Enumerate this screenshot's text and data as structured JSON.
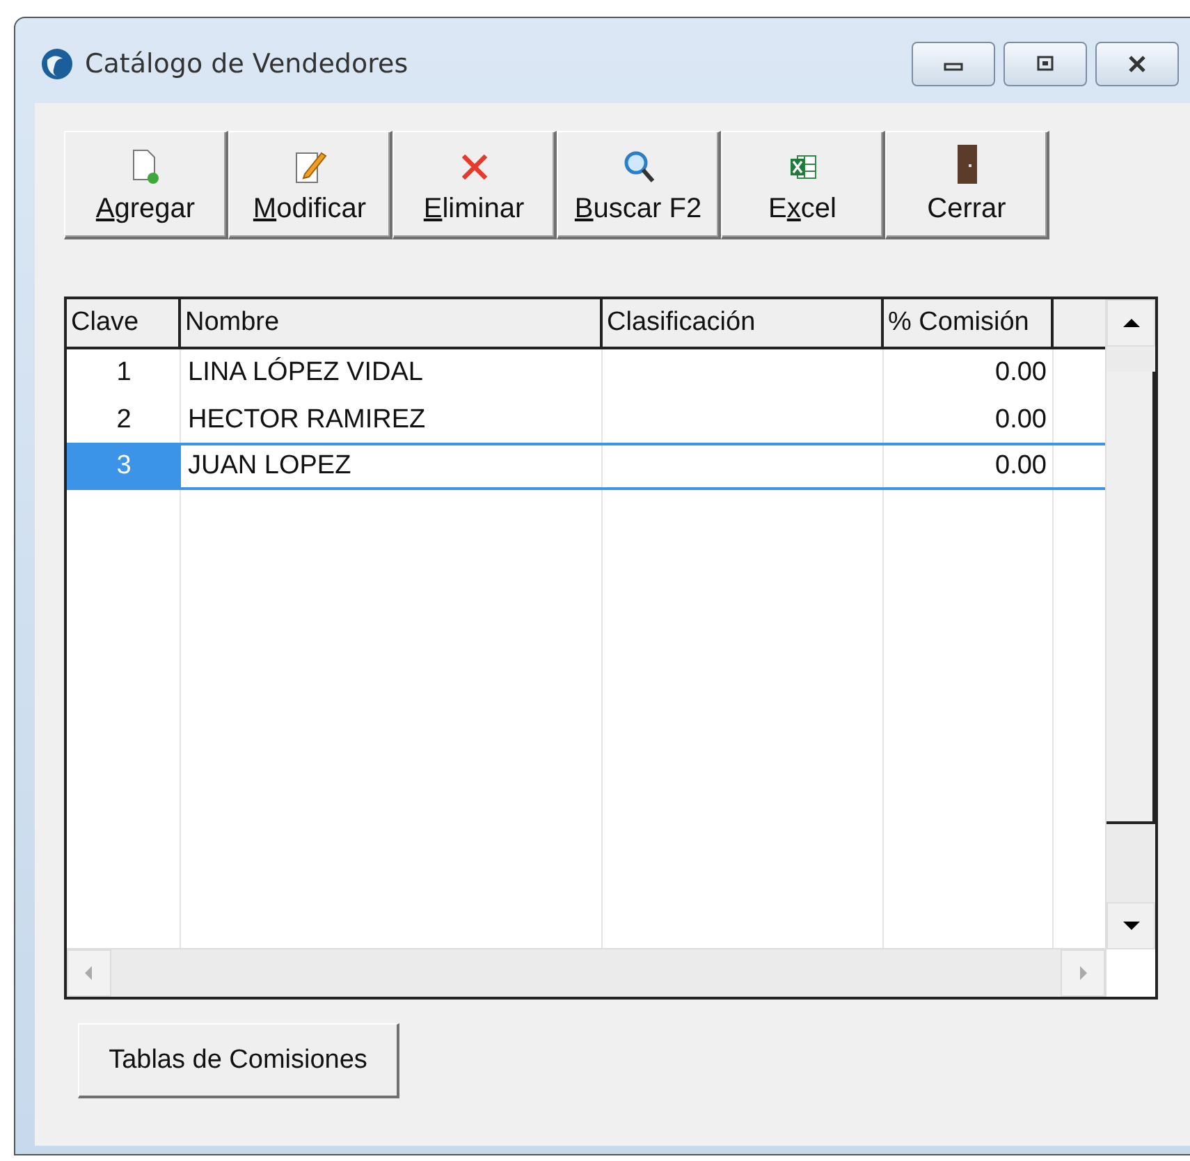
{
  "window": {
    "title": "Catálogo de Vendedores"
  },
  "toolbar": [
    {
      "kind": "add",
      "key": "A",
      "post": "gregar"
    },
    {
      "kind": "edit",
      "key": "M",
      "post": "odificar"
    },
    {
      "kind": "delete",
      "key": "E",
      "post": "liminar"
    },
    {
      "kind": "search",
      "key": "B",
      "post": "uscar F2"
    },
    {
      "kind": "excel",
      "pre": "E",
      "key": "x",
      "post": "cel"
    },
    {
      "kind": "exit",
      "pre": "Cerrar"
    }
  ],
  "table": {
    "columns": [
      "Clave",
      "Nombre",
      "Clasificación",
      "% Comisión"
    ],
    "rows": [
      {
        "clave": "1",
        "nombre": "LINA LÓPEZ VIDAL",
        "comision": "0.00",
        "selected": false
      },
      {
        "clave": "2",
        "nombre": "HECTOR RAMIREZ",
        "comision": "0.00",
        "selected": false
      },
      {
        "clave": "3",
        "nombre": "JUAN LOPEZ",
        "comision": "0.00",
        "selected": true
      }
    ]
  },
  "buttons": [
    "Tablas de Comisiones"
  ]
}
